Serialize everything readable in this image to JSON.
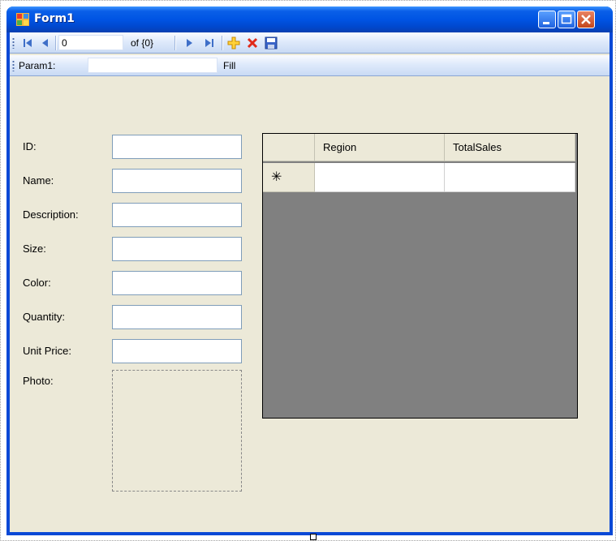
{
  "window": {
    "title": "Form1"
  },
  "navigator": {
    "position_value": "0",
    "count_text": "of {0}"
  },
  "fill_toolbar": {
    "param_label": "Param1:",
    "param_value": "",
    "fill_label": "Fill"
  },
  "form": {
    "labels": {
      "id": "ID:",
      "name": "Name:",
      "description": "Description:",
      "size": "Size:",
      "color": "Color:",
      "quantity": "Quantity:",
      "unit_price": "Unit Price:",
      "photo": "Photo:"
    }
  },
  "grid": {
    "columns": [
      "Region",
      "TotalSales"
    ],
    "new_row_marker": "✳"
  },
  "colors": {
    "titlebar": "#0054e3",
    "client_bg": "#ece9d8",
    "grid_bg": "#808080"
  }
}
